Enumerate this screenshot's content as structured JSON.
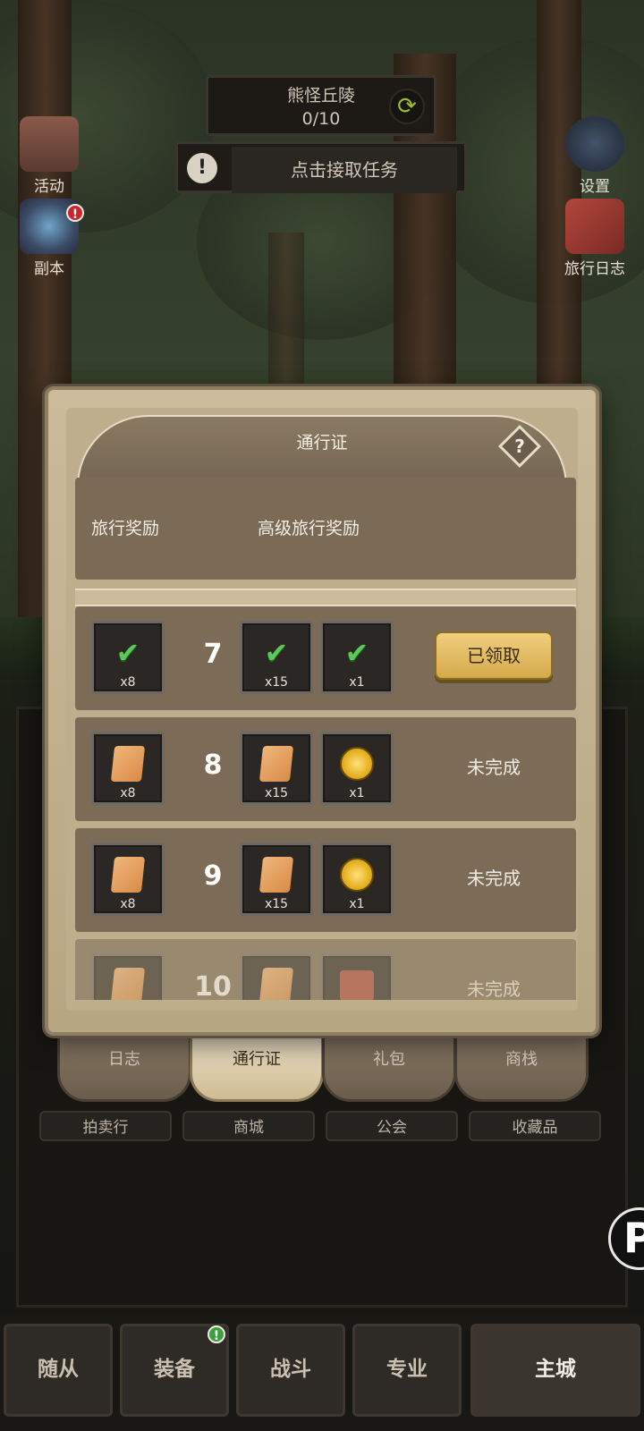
{
  "quest": {
    "title": "熊怪丘陵",
    "progress": "0/10",
    "accept_label": "点击接取任务"
  },
  "side": {
    "activity": "活动",
    "dungeon": "副本",
    "settings": "设置",
    "journal": "旅行日志"
  },
  "behind_tabs": [
    "日志",
    "通行证",
    "礼包",
    "商栈"
  ],
  "behind_labels": [
    "拍卖行",
    "商城",
    "公会",
    "收藏品"
  ],
  "bottom_tabs": {
    "follower": "随从",
    "equipment": "装备",
    "combat": "战斗",
    "profession": "专业",
    "main_city": "主城"
  },
  "modal": {
    "title": "通行证",
    "help": "?",
    "col_free": "旅行奖励",
    "col_premium": "高级旅行奖励",
    "rows": [
      {
        "level": "7",
        "free": {
          "icon": "check-icon",
          "qty": "x8"
        },
        "p1": {
          "icon": "check-icon",
          "qty": "x15"
        },
        "p2": {
          "icon": "check-icon",
          "qty": "x1"
        },
        "status": "已领取"
      },
      {
        "level": "8",
        "free": {
          "icon": "scroll-icon",
          "qty": "x8"
        },
        "p1": {
          "icon": "scroll-icon",
          "qty": "x15"
        },
        "p2": {
          "icon": "coin-icon",
          "qty": "x1"
        },
        "status": "未完成"
      },
      {
        "level": "9",
        "free": {
          "icon": "scroll-icon",
          "qty": "x8"
        },
        "p1": {
          "icon": "scroll-icon",
          "qty": "x15"
        },
        "p2": {
          "icon": "coin-icon",
          "qty": "x1"
        },
        "status": "未完成"
      },
      {
        "level": "10",
        "free": {
          "icon": "scroll-icon",
          "qty": ""
        },
        "p1": {
          "icon": "scroll-icon",
          "qty": ""
        },
        "p2": {
          "icon": "book-icon",
          "qty": ""
        },
        "status": "未完成"
      }
    ]
  },
  "badges": {
    "dungeon": "!",
    "equipment": "!"
  },
  "colors": {
    "accent_gold": "#d4a94a",
    "panel_brown": "#7b6b57",
    "check_green": "#59c95a"
  }
}
